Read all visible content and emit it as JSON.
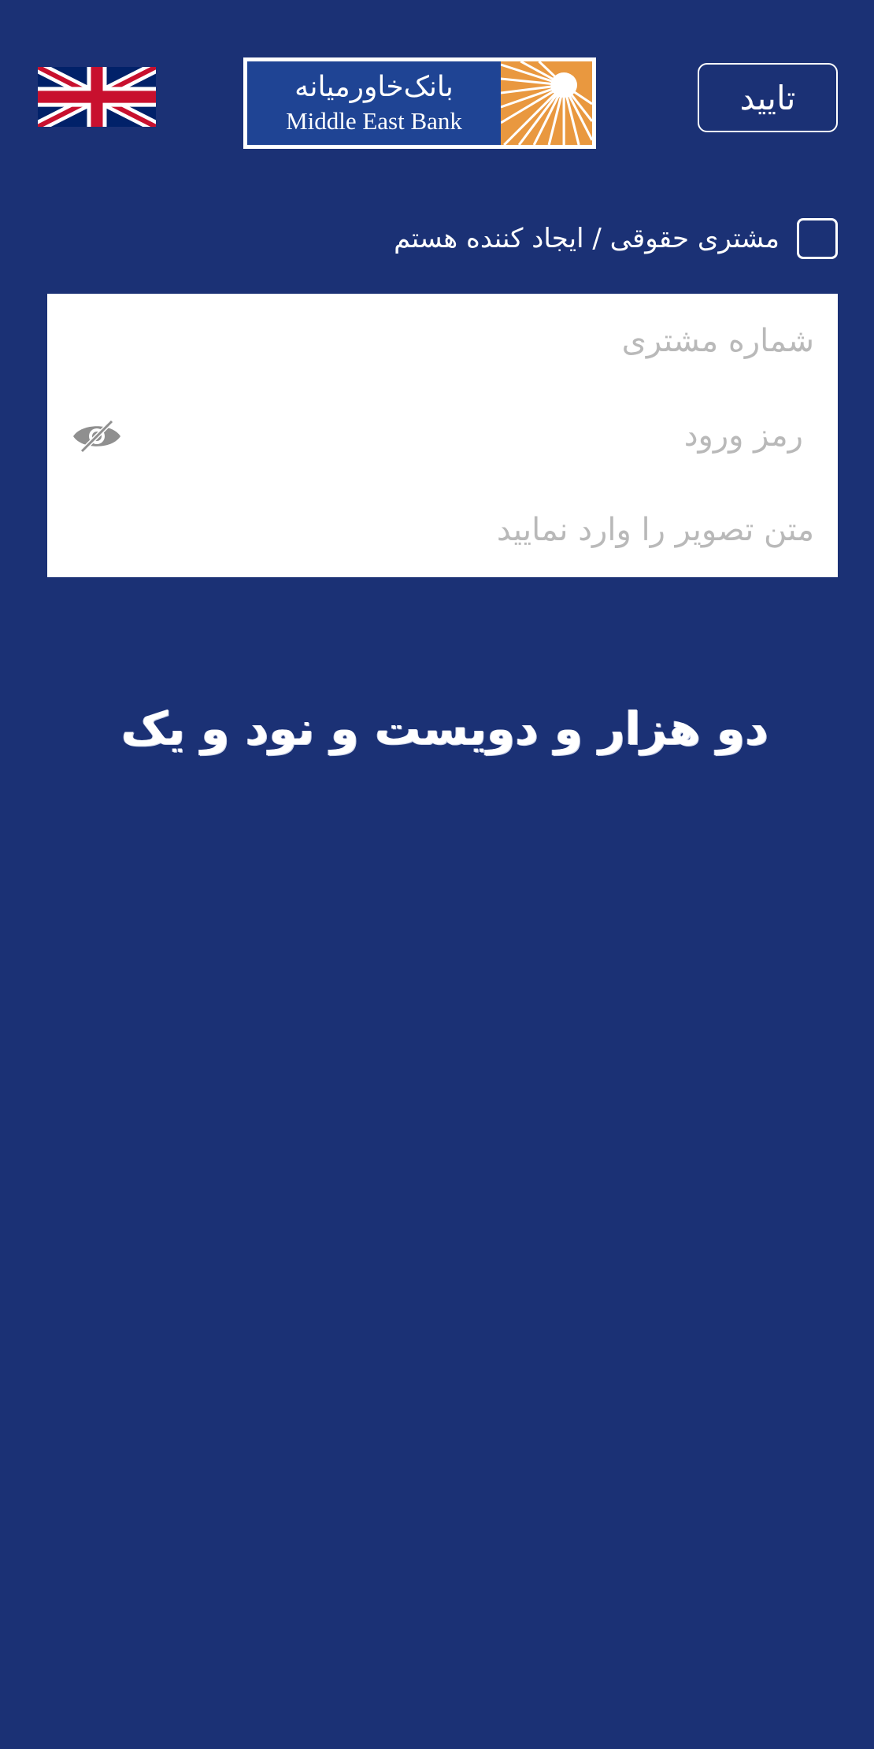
{
  "header": {
    "language_icon": "uk-flag-icon",
    "logo": {
      "name_fa": "بانک‌خاورمیانه",
      "name_en": "Middle East Bank",
      "brand_blue": "#1f4494",
      "brand_orange": "#e9983f"
    },
    "confirm_label": "تایید"
  },
  "legal_customer": {
    "label": "مشتری حقوقی / ایجاد کننده هستم",
    "checked": false
  },
  "form": {
    "customer_number_placeholder": "شماره مشتری",
    "password_placeholder": "رمز ورود",
    "password_toggle_icon": "eye-slash-icon",
    "captcha_placeholder": "متن تصویر را وارد نمایید"
  },
  "captcha": {
    "text": "دو هزار و دویست و نود و یک"
  },
  "colors": {
    "background": "#1b3175",
    "field_background": "#ffffff",
    "placeholder": "#b9b9b9"
  }
}
